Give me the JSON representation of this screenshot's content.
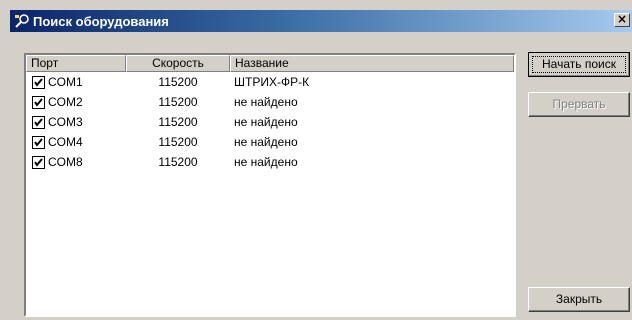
{
  "window": {
    "title": "Поиск оборудования",
    "close_symbol": "×",
    "icon": "magnifier-device-icon"
  },
  "list": {
    "columns": [
      "Порт",
      "Скорость",
      "Название"
    ],
    "rows": [
      {
        "checked": true,
        "port": "COM1",
        "speed": "115200",
        "name": "ШТРИХ-ФР-К"
      },
      {
        "checked": true,
        "port": "COM2",
        "speed": "115200",
        "name": "не найдено"
      },
      {
        "checked": true,
        "port": "COM3",
        "speed": "115200",
        "name": "не найдено"
      },
      {
        "checked": true,
        "port": "COM4",
        "speed": "115200",
        "name": "не найдено"
      },
      {
        "checked": true,
        "port": "COM8",
        "speed": "115200",
        "name": "не найдено"
      }
    ]
  },
  "buttons": {
    "start_search": "Начать поиск",
    "abort": "Прервать",
    "close": "Закрыть"
  },
  "colors": {
    "titlebar_start": "#0a246a",
    "titlebar_end": "#a6caf0",
    "face": "#d4d0c8"
  }
}
